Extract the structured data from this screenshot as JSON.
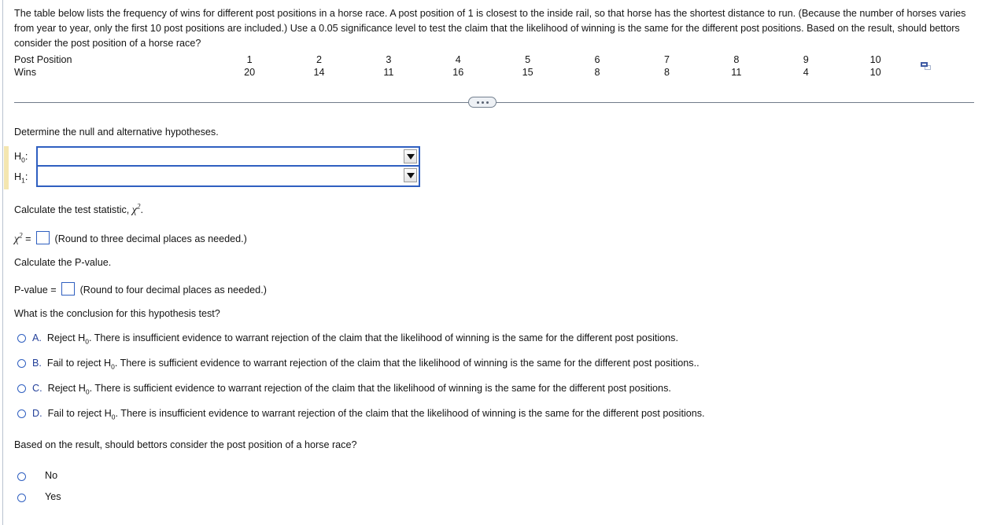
{
  "problem": {
    "statement": "The table below lists the frequency of wins for different post positions in a horse race. A post position of 1 is closest to the inside rail, so that horse has the shortest distance to run. (Because the number of horses varies from year to year, only the first 10 post positions are included.) Use a 0.05 significance level to test the claim that the likelihood of winning is the same for the different post positions. Based on the result, should bettors consider the post position of a horse race?"
  },
  "chart_data": {
    "type": "table",
    "title": "Frequency of wins by post position",
    "row_headers": [
      "Post Position",
      "Wins"
    ],
    "categories": [
      "1",
      "2",
      "3",
      "4",
      "5",
      "6",
      "7",
      "8",
      "9",
      "10"
    ],
    "xlabel": "Post Position",
    "ylabel": "Wins",
    "values": [
      20,
      14,
      11,
      16,
      15,
      8,
      8,
      11,
      4,
      10
    ],
    "series": [
      {
        "name": "Wins",
        "values": [
          20,
          14,
          11,
          16,
          15,
          8,
          8,
          11,
          4,
          10
        ]
      }
    ]
  },
  "table": {
    "copy_icon": "copy-to-spreadsheet-icon"
  },
  "divider": {
    "expander_icon": "ellipsis-icon"
  },
  "hypotheses": {
    "prompt": "Determine the null and alternative hypotheses.",
    "rows": [
      {
        "label": "H₀:",
        "value": "",
        "arrow_icon": "chevron-down-icon"
      },
      {
        "label": "H₁:",
        "value": "",
        "arrow_icon": "chevron-down-icon"
      }
    ]
  },
  "test_statistic": {
    "prompt_pre": "Calculate the test statistic, ",
    "prompt_symbol": "χ",
    "prompt_sup": "2",
    "prompt_post": ".",
    "equation_symbol": "χ",
    "equation_sup": "2",
    "equals": "=",
    "value": "",
    "hint": "(Round to three decimal places as needed.)"
  },
  "p_value": {
    "prompt": "Calculate the P-value.",
    "label": "P-value =",
    "value": "",
    "hint": "(Round to four decimal places as needed.)"
  },
  "conclusion": {
    "prompt": "What is the conclusion for this hypothesis test?",
    "options": [
      {
        "letter": "A.",
        "pre": "Reject H",
        "sub": "0",
        "post": ". There is insufficient evidence to warrant rejection of the claim that the likelihood of winning is the same for the different post positions."
      },
      {
        "letter": "B.",
        "pre": "Fail to reject H",
        "sub": "0",
        "post": ". There is sufficient evidence to warrant rejection of the claim that the likelihood of winning is the same for the different post positions.."
      },
      {
        "letter": "C.",
        "pre": "Reject H",
        "sub": "0",
        "post": ". There is sufficient evidence to warrant rejection of the claim that the likelihood of winning is the same for the different post positions."
      },
      {
        "letter": "D.",
        "pre": "Fail to reject H",
        "sub": "0",
        "post": ". There is insufficient evidence to warrant rejection of the claim that the likelihood of winning is the same for the different post positions."
      }
    ]
  },
  "bettors": {
    "prompt": "Based on the result, should bettors consider the post position of a horse race?",
    "options": [
      {
        "label": "No"
      },
      {
        "label": "Yes"
      }
    ]
  },
  "colors": {
    "accent_blue": "#2f5fc0",
    "letter_blue": "#23409a",
    "highlight_yellow": "#f4e6b0",
    "rail_gray": "#b9c2d0",
    "text": "#141414"
  }
}
